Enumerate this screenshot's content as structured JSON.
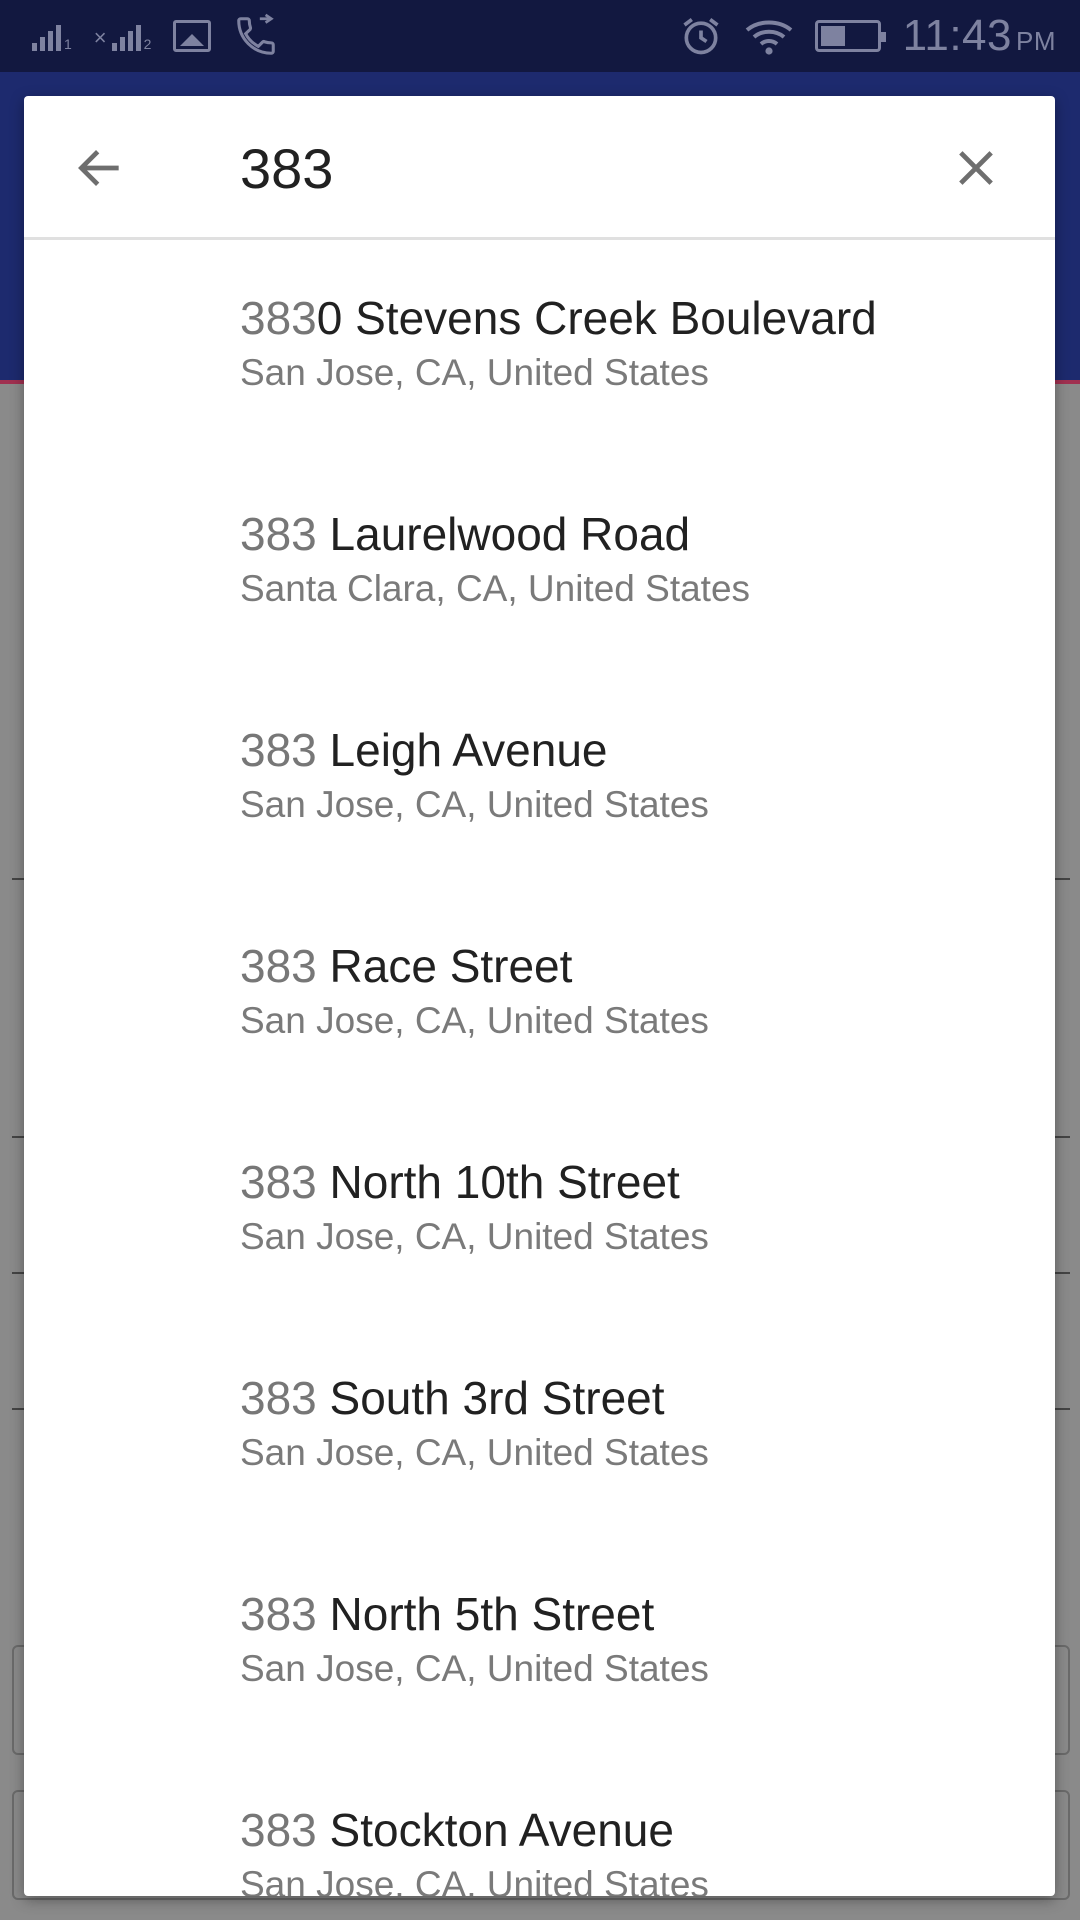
{
  "status_bar": {
    "time": "11:43",
    "ampm": "PM",
    "sim1_label": "1",
    "sim2_label": "2",
    "icons": [
      "signal-sim1-icon",
      "signal-sim2-icon",
      "image-notification-icon",
      "call-forward-icon",
      "alarm-icon",
      "wifi-icon",
      "battery-icon"
    ]
  },
  "search": {
    "query": "383",
    "back_icon": "arrow-back-icon",
    "clear_icon": "close-icon"
  },
  "results": [
    {
      "match": "383",
      "rest": "0 Stevens Creek Boulevard",
      "secondary": "San Jose, CA, United States"
    },
    {
      "match": "383",
      "rest": " Laurelwood Road",
      "secondary": "Santa Clara, CA, United States"
    },
    {
      "match": "383",
      "rest": " Leigh Avenue",
      "secondary": "San Jose, CA, United States"
    },
    {
      "match": "383",
      "rest": " Race Street",
      "secondary": "San Jose, CA, United States"
    },
    {
      "match": "383",
      "rest": " North 10th Street",
      "secondary": "San Jose, CA, United States"
    },
    {
      "match": "383",
      "rest": " South 3rd Street",
      "secondary": "San Jose, CA, United States"
    },
    {
      "match": "383",
      "rest": " North 5th Street",
      "secondary": "San Jose, CA, United States"
    },
    {
      "match": "383",
      "rest": " Stockton Avenue",
      "secondary": "San Jose, CA, United States"
    }
  ],
  "colors": {
    "status_bar_bg": "#121840",
    "app_bar_bg": "#1d2a6e",
    "scrim": "#8a8a8a",
    "primary_text": "#212121",
    "secondary_text": "#7a7a7a"
  }
}
